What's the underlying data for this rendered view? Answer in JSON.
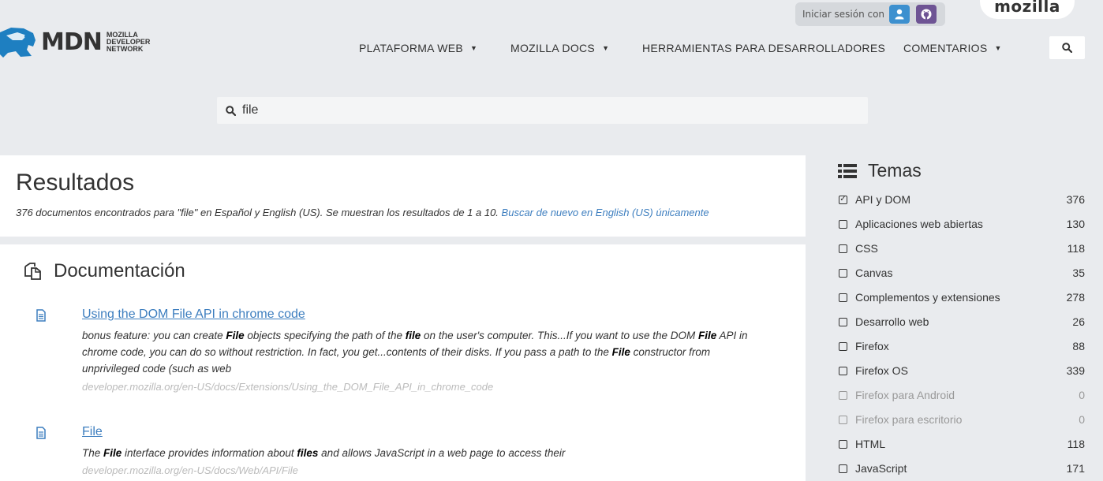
{
  "header": {
    "login_label": "Iniciar sesión con",
    "mozilla_label": "mozilla",
    "logo": {
      "wordmark": "MDN",
      "subtitle_line1": "MOZILLA",
      "subtitle_line2": "DEVELOPER",
      "subtitle_line3": "NETWORK"
    },
    "nav": [
      {
        "label": "PLATAFORMA WEB",
        "has_caret": true
      },
      {
        "label": "MOZILLA DOCS",
        "has_caret": true
      },
      {
        "label": "HERRAMIENTAS PARA DESARROLLADORES",
        "has_caret": false
      },
      {
        "label": "COMENTARIOS",
        "has_caret": true
      }
    ]
  },
  "search": {
    "value": "file"
  },
  "results": {
    "title": "Resultados",
    "summary_text": "376 documentos encontrados para \"file\" en Español y English (US). Se muestran los resultados de 1 a 10.",
    "summary_link": "Buscar de nuevo en English (US) únicamente"
  },
  "documentation": {
    "heading": "Documentación",
    "items": [
      {
        "title": "Using the DOM File API in chrome code",
        "excerpt_parts": [
          "bonus feature: you can create ",
          "File",
          " objects specifying the path of the ",
          "file",
          " on the user's computer. This...If you want to use the DOM ",
          "File",
          " API in chrome code, you can do so without restriction. In fact, you get...contents of their disks. If you pass a path to the ",
          "File",
          " constructor from unprivileged code (such as web"
        ],
        "url": "developer.mozilla.org/en-US/docs/Extensions/Using_the_DOM_File_API_in_chrome_code"
      },
      {
        "title": "File",
        "excerpt_parts": [
          "The ",
          "File",
          " interface provides information about ",
          "files",
          " and allows JavaScript in a web page to access their"
        ],
        "url": "developer.mozilla.org/en-US/docs/Web/API/File"
      }
    ]
  },
  "sidebar": {
    "heading": "Temas",
    "topics": [
      {
        "label": "API y DOM",
        "count": "376",
        "checked": true,
        "disabled": false
      },
      {
        "label": "Aplicaciones web abiertas",
        "count": "130",
        "checked": false,
        "disabled": false
      },
      {
        "label": "CSS",
        "count": "118",
        "checked": false,
        "disabled": false
      },
      {
        "label": "Canvas",
        "count": "35",
        "checked": false,
        "disabled": false
      },
      {
        "label": "Complementos y extensiones",
        "count": "278",
        "checked": false,
        "disabled": false
      },
      {
        "label": "Desarrollo web",
        "count": "26",
        "checked": false,
        "disabled": false
      },
      {
        "label": "Firefox",
        "count": "88",
        "checked": false,
        "disabled": false
      },
      {
        "label": "Firefox OS",
        "count": "339",
        "checked": false,
        "disabled": false
      },
      {
        "label": "Firefox para Android",
        "count": "0",
        "checked": false,
        "disabled": true
      },
      {
        "label": "Firefox para escritorio",
        "count": "0",
        "checked": false,
        "disabled": true
      },
      {
        "label": "HTML",
        "count": "118",
        "checked": false,
        "disabled": false
      },
      {
        "label": "JavaScript",
        "count": "171",
        "checked": false,
        "disabled": false
      }
    ]
  },
  "colors": {
    "link": "#3d7ebf",
    "persona_button": "#3d90cf",
    "github_button": "#6e5494",
    "page_background": "#e9ebee"
  }
}
